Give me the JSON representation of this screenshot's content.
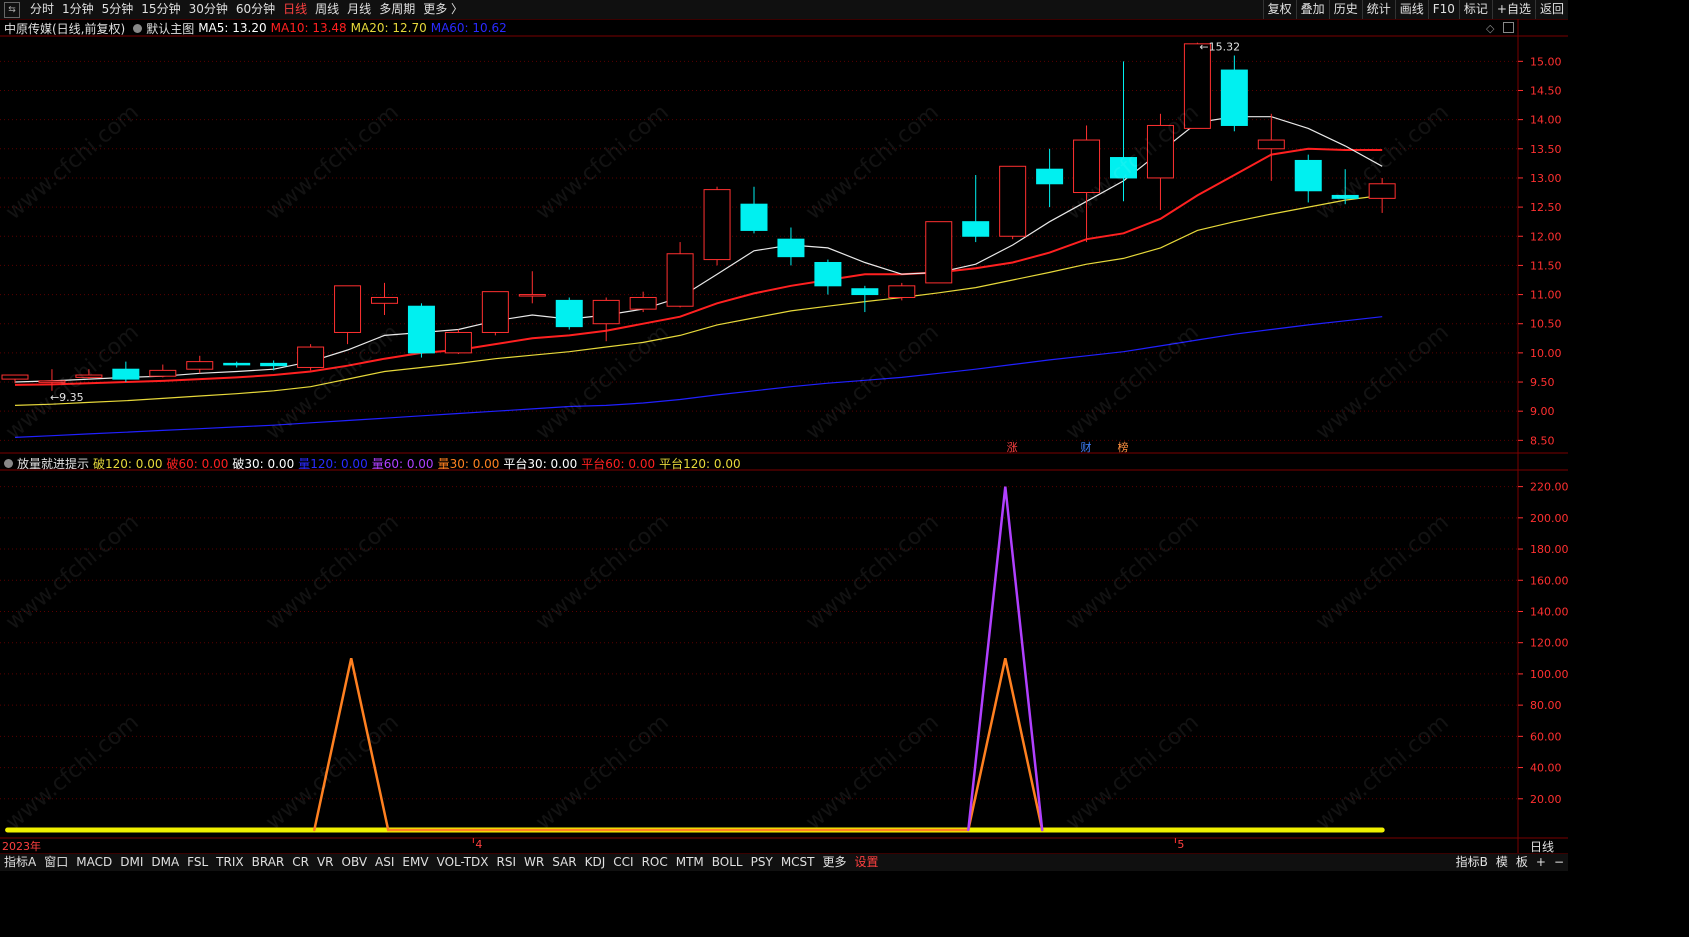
{
  "topbar": {
    "periods": [
      "分时",
      "1分钟",
      "5分钟",
      "15分钟",
      "30分钟",
      "60分钟",
      "日线",
      "周线",
      "月线",
      "多周期",
      "更多 〉"
    ],
    "active_period": "日线",
    "right_buttons": [
      "复权",
      "叠加",
      "历史",
      "统计",
      "画线",
      "F10",
      "标记",
      "+自选",
      "返回"
    ]
  },
  "main_legend": {
    "stock": "中原传媒(日线,前复权)",
    "template": "默认主图",
    "ma5": "MA5: 13.20",
    "ma10": "MA10: 13.48",
    "ma20": "MA20: 12.70",
    "ma60": "MA60: 10.62",
    "colors": {
      "ma5": "#ffffff",
      "ma10": "#ff2020",
      "ma20": "#e6d83a",
      "ma60": "#2a2aff"
    }
  },
  "indicator_legend": {
    "name": "放量就进提示",
    "items": [
      {
        "text": "破120: 0.00",
        "color": "#e6d83a"
      },
      {
        "text": "破60: 0.00",
        "color": "#ff2020"
      },
      {
        "text": "破30: 0.00",
        "color": "#ffffff"
      },
      {
        "text": "量120: 0.00",
        "color": "#2a2aff"
      },
      {
        "text": "量60: 0.00",
        "color": "#b040ff"
      },
      {
        "text": "量30: 0.00",
        "color": "#ff8020"
      },
      {
        "text": "平台30: 0.00",
        "color": "#ffffff"
      },
      {
        "text": "平台60: 0.00",
        "color": "#ff2020"
      },
      {
        "text": "平台120: 0.00",
        "color": "#e6d83a"
      }
    ]
  },
  "right_panel": {
    "label": "日线"
  },
  "markers": [
    {
      "text": "涨",
      "color": "#ff4040",
      "index": 27
    },
    {
      "text": "财",
      "color": "#4080ff",
      "index": 29
    },
    {
      "text": "榜",
      "color": "#ff9040",
      "index": 30
    }
  ],
  "x_axis_labels": [
    {
      "text": "2023年",
      "index": 0
    },
    {
      "text": "4",
      "index": 13
    },
    {
      "text": "5",
      "index": 32
    }
  ],
  "bottombar": {
    "tabs": [
      "指标A",
      "窗口",
      "MACD",
      "DMI",
      "DMA",
      "FSL",
      "TRIX",
      "BRAR",
      "CR",
      "VR",
      "OBV",
      "ASI",
      "EMV",
      "VOL-TDX",
      "RSI",
      "WR",
      "SAR",
      "KDJ",
      "CCI",
      "ROC",
      "MTM",
      "BOLL",
      "PSY",
      "MCST",
      "更多",
      "设置"
    ],
    "active_tab": "设置",
    "right": [
      "指标B",
      "模",
      "板",
      "+",
      "−"
    ]
  },
  "watermark": "www.cfchi.com",
  "chart_data": [
    {
      "type": "candlestick",
      "title": "中原传媒(日线,前复权)",
      "ylim": [
        8.3,
        15.4
      ],
      "yticks": [
        8.5,
        9.0,
        9.5,
        10.0,
        10.5,
        11.0,
        11.5,
        12.0,
        12.5,
        13.0,
        13.5,
        14.0,
        14.5,
        15.0
      ],
      "candles": [
        {
          "o": 9.55,
          "h": 9.62,
          "l": 9.48,
          "c": 9.62
        },
        {
          "o": 9.5,
          "h": 9.72,
          "l": 9.35,
          "c": 9.52
        },
        {
          "o": 9.58,
          "h": 9.72,
          "l": 9.55,
          "c": 9.62
        },
        {
          "o": 9.72,
          "h": 9.85,
          "l": 9.5,
          "c": 9.55
        },
        {
          "o": 9.6,
          "h": 9.8,
          "l": 9.58,
          "c": 9.7
        },
        {
          "o": 9.72,
          "h": 9.95,
          "l": 9.65,
          "c": 9.85
        },
        {
          "o": 9.82,
          "h": 9.85,
          "l": 9.75,
          "c": 9.8
        },
        {
          "o": 9.82,
          "h": 9.87,
          "l": 9.7,
          "c": 9.78
        },
        {
          "o": 9.75,
          "h": 10.15,
          "l": 9.7,
          "c": 10.1
        },
        {
          "o": 10.35,
          "h": 11.15,
          "l": 10.15,
          "c": 11.15
        },
        {
          "o": 10.85,
          "h": 11.2,
          "l": 10.65,
          "c": 10.95
        },
        {
          "o": 10.8,
          "h": 10.85,
          "l": 9.92,
          "c": 10.0
        },
        {
          "o": 10.0,
          "h": 10.4,
          "l": 9.98,
          "c": 10.35
        },
        {
          "o": 10.35,
          "h": 11.05,
          "l": 10.3,
          "c": 11.05
        },
        {
          "o": 11.0,
          "h": 11.4,
          "l": 10.85,
          "c": 11.0
        },
        {
          "o": 10.9,
          "h": 10.95,
          "l": 10.4,
          "c": 10.45
        },
        {
          "o": 10.5,
          "h": 10.95,
          "l": 10.2,
          "c": 10.9
        },
        {
          "o": 10.75,
          "h": 11.05,
          "l": 10.7,
          "c": 10.95
        },
        {
          "o": 10.8,
          "h": 11.9,
          "l": 10.78,
          "c": 11.7
        },
        {
          "o": 11.6,
          "h": 12.85,
          "l": 11.5,
          "c": 12.8
        },
        {
          "o": 12.55,
          "h": 12.85,
          "l": 12.05,
          "c": 12.1
        },
        {
          "o": 11.95,
          "h": 12.15,
          "l": 11.5,
          "c": 11.65
        },
        {
          "o": 11.55,
          "h": 11.6,
          "l": 11.0,
          "c": 11.15
        },
        {
          "o": 11.1,
          "h": 11.15,
          "l": 10.7,
          "c": 11.0
        },
        {
          "o": 10.95,
          "h": 11.2,
          "l": 10.9,
          "c": 11.15
        },
        {
          "o": 11.2,
          "h": 12.25,
          "l": 11.2,
          "c": 12.25
        },
        {
          "o": 12.25,
          "h": 13.05,
          "l": 11.9,
          "c": 12.0
        },
        {
          "o": 12.0,
          "h": 13.2,
          "l": 11.95,
          "c": 13.2
        },
        {
          "o": 13.15,
          "h": 13.5,
          "l": 12.5,
          "c": 12.9
        },
        {
          "o": 12.75,
          "h": 13.9,
          "l": 11.9,
          "c": 13.65
        },
        {
          "o": 13.35,
          "h": 15.0,
          "l": 12.6,
          "c": 13.0
        },
        {
          "o": 13.0,
          "h": 14.1,
          "l": 12.45,
          "c": 13.9
        },
        {
          "o": 13.85,
          "h": 15.32,
          "l": 13.85,
          "c": 15.3
        },
        {
          "o": 14.85,
          "h": 15.1,
          "l": 13.8,
          "c": 13.9
        },
        {
          "o": 13.5,
          "h": 14.1,
          "l": 12.95,
          "c": 13.65
        },
        {
          "o": 13.3,
          "h": 13.4,
          "l": 12.58,
          "c": 12.78
        },
        {
          "o": 12.7,
          "h": 13.15,
          "l": 12.55,
          "c": 12.65
        },
        {
          "o": 12.65,
          "h": 13.0,
          "l": 12.4,
          "c": 12.9
        }
      ],
      "ma5": [
        9.5,
        9.52,
        9.55,
        9.58,
        9.6,
        9.65,
        9.68,
        9.72,
        9.85,
        10.05,
        10.3,
        10.35,
        10.4,
        10.55,
        10.65,
        10.58,
        10.65,
        10.75,
        10.95,
        11.35,
        11.75,
        11.85,
        11.8,
        11.55,
        11.35,
        11.38,
        11.52,
        11.85,
        12.25,
        12.6,
        12.95,
        13.45,
        13.95,
        14.05,
        14.05,
        13.85,
        13.55,
        13.2
      ],
      "ma10": [
        9.45,
        9.46,
        9.48,
        9.5,
        9.52,
        9.55,
        9.58,
        9.62,
        9.68,
        9.78,
        9.9,
        10.0,
        10.05,
        10.15,
        10.25,
        10.3,
        10.38,
        10.5,
        10.62,
        10.85,
        11.02,
        11.15,
        11.25,
        11.35,
        11.35,
        11.38,
        11.45,
        11.55,
        11.72,
        11.95,
        12.05,
        12.3,
        12.7,
        13.05,
        13.4,
        13.5,
        13.48,
        13.48
      ],
      "ma20": [
        9.1,
        9.12,
        9.15,
        9.18,
        9.22,
        9.26,
        9.3,
        9.35,
        9.42,
        9.55,
        9.68,
        9.75,
        9.82,
        9.9,
        9.96,
        10.02,
        10.1,
        10.18,
        10.3,
        10.48,
        10.6,
        10.72,
        10.8,
        10.88,
        10.95,
        11.03,
        11.12,
        11.25,
        11.38,
        11.52,
        11.62,
        11.8,
        12.1,
        12.25,
        12.38,
        12.5,
        12.62,
        12.7
      ],
      "ma60": [
        8.55,
        8.58,
        8.61,
        8.64,
        8.67,
        8.7,
        8.73,
        8.76,
        8.8,
        8.84,
        8.88,
        8.92,
        8.96,
        9.0,
        9.04,
        9.08,
        9.1,
        9.14,
        9.2,
        9.28,
        9.35,
        9.42,
        9.48,
        9.53,
        9.58,
        9.65,
        9.72,
        9.8,
        9.88,
        9.95,
        10.02,
        10.12,
        10.22,
        10.32,
        10.4,
        10.48,
        10.55,
        10.62
      ],
      "annotations": [
        {
          "text": "15.32",
          "index": 32
        },
        {
          "text": "9.35",
          "index": 1
        }
      ]
    },
    {
      "type": "line",
      "title": "放量就进提示",
      "ylim": [
        0,
        230
      ],
      "yticks": [
        20,
        40,
        60,
        80,
        100,
        120,
        140,
        160,
        180,
        200,
        220
      ],
      "series": [
        {
          "name": "量60",
          "color": "#b040ff",
          "points": [
            [
              25.8,
              0
            ],
            [
              26.8,
              220
            ],
            [
              27.8,
              0
            ]
          ]
        },
        {
          "name": "量30",
          "color": "#ff8020",
          "points": [
            [
              8.1,
              0
            ],
            [
              9.1,
              110
            ],
            [
              10.1,
              0
            ],
            [
              25.8,
              0
            ],
            [
              26.8,
              110
            ],
            [
              27.8,
              0
            ]
          ]
        },
        {
          "name": "破120",
          "color": "#f0f000",
          "points": [
            [
              -0.2,
              0
            ],
            [
              37.0,
              0
            ]
          ]
        }
      ]
    }
  ]
}
